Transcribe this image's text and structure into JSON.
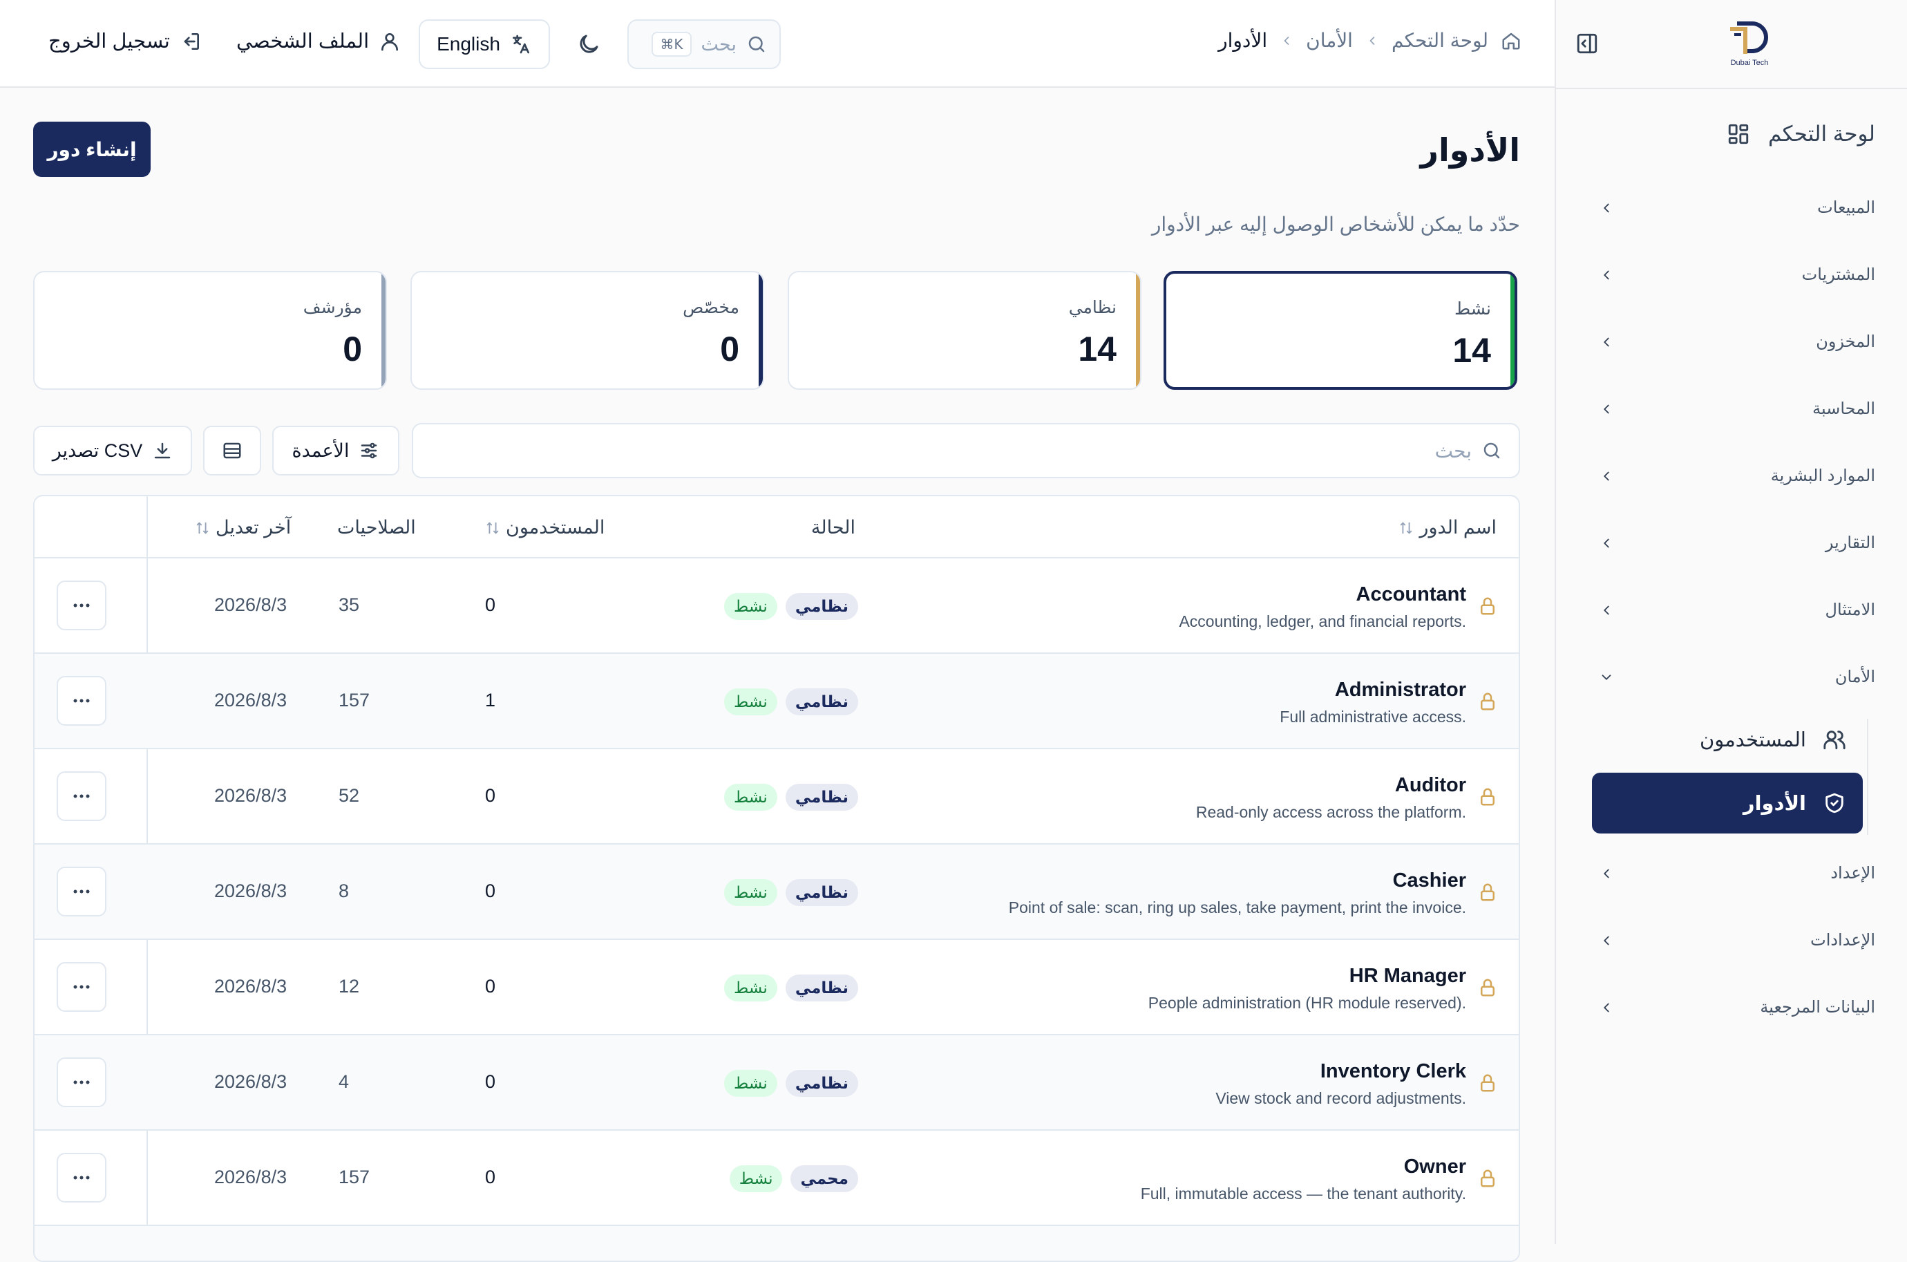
{
  "brand": {
    "logo_text": "Dubai Tech"
  },
  "breadcrumb": {
    "home": "لوحة التحكم",
    "section": "الأمان",
    "current": "الأدوار"
  },
  "topbar": {
    "search_placeholder": "بحث",
    "search_shortcut": "⌘K",
    "language": "English",
    "profile": "الملف الشخصي",
    "logout": "تسجيل الخروج"
  },
  "sidebar": {
    "dashboard": "لوحة التحكم",
    "items": [
      "المبيعات",
      "المشتريات",
      "المخزون",
      "المحاسبة",
      "الموارد البشرية",
      "التقارير",
      "الامتثال",
      "الأمان"
    ],
    "security_sub": [
      "المستخدمون",
      "الأدوار"
    ],
    "items_after": [
      "الإعداد",
      "الإعدادات",
      "البيانات المرجعية"
    ]
  },
  "page": {
    "title": "الأدوار",
    "subtitle": "حدّد ما يمكن للأشخاص الوصول إليه عبر الأدوار",
    "create_button": "إنشاء دور"
  },
  "stats": [
    {
      "label": "نشط",
      "value": "14",
      "accent": "#16a34a"
    },
    {
      "label": "نظامي",
      "value": "14",
      "accent": "#d4a657"
    },
    {
      "label": "مخصّص",
      "value": "0",
      "accent": "#1b2a5e"
    },
    {
      "label": "مؤرشف",
      "value": "0",
      "accent": "#94a3b8"
    }
  ],
  "toolbar": {
    "search_placeholder": "بحث",
    "columns": "الأعمدة",
    "export": "تصدير CSV"
  },
  "table": {
    "headers": {
      "name": "اسم الدور",
      "status": "الحالة",
      "users": "المستخدمون",
      "permissions": "الصلاحيات",
      "modified": "آخر تعديل"
    },
    "rows": [
      {
        "name": "Accountant",
        "desc": "Accounting, ledger, and financial reports.",
        "type": "نظامي",
        "status": "نشط",
        "users": "0",
        "perms": "35",
        "date": "2026/8/3"
      },
      {
        "name": "Administrator",
        "desc": "Full administrative access.",
        "type": "نظامي",
        "status": "نشط",
        "users": "1",
        "perms": "157",
        "date": "2026/8/3"
      },
      {
        "name": "Auditor",
        "desc": "Read-only access across the platform.",
        "type": "نظامي",
        "status": "نشط",
        "users": "0",
        "perms": "52",
        "date": "2026/8/3"
      },
      {
        "name": "Cashier",
        "desc": "Point of sale: scan, ring up sales, take payment, print the invoice.",
        "type": "نظامي",
        "status": "نشط",
        "users": "0",
        "perms": "8",
        "date": "2026/8/3"
      },
      {
        "name": "HR Manager",
        "desc": "People administration (HR module reserved).",
        "type": "نظامي",
        "status": "نشط",
        "users": "0",
        "perms": "12",
        "date": "2026/8/3"
      },
      {
        "name": "Inventory Clerk",
        "desc": "View stock and record adjustments.",
        "type": "نظامي",
        "status": "نشط",
        "users": "0",
        "perms": "4",
        "date": "2026/8/3"
      },
      {
        "name": "Owner",
        "desc": "Full, immutable access — the tenant authority.",
        "type": "محمي",
        "status": "نشط",
        "users": "0",
        "perms": "157",
        "date": "2026/8/3"
      }
    ]
  }
}
